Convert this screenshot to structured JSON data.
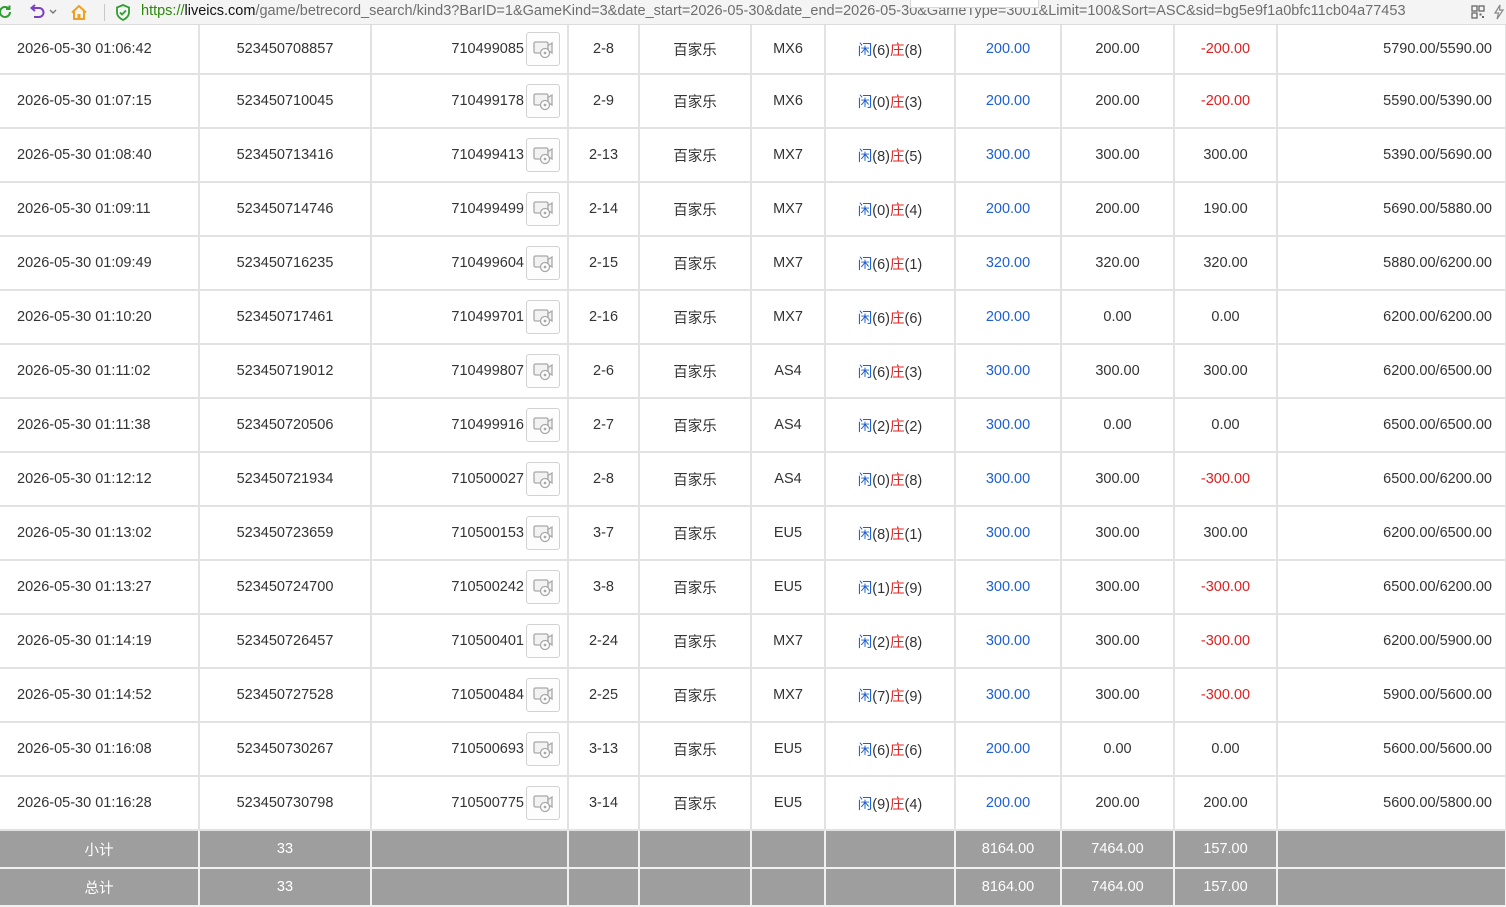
{
  "browser": {
    "url_scheme": "https://",
    "url_host": "liveics.com",
    "url_rest": "/game/betrecord_search/kind3?BarID=1&GameKind=3&date_start=2026-05-30&date_end=2026-05-30&GameType=3001&Limit=100&Sort=ASC&sid=bg5e9f1a0bfc11cb04a77453"
  },
  "player_label": "闲",
  "banker_label": "庄",
  "rows": [
    {
      "time": "2026-05-30 01:06:42",
      "bet_no": "523450708857",
      "game_no": "710499085",
      "shoe": "2-8",
      "game": "百家乐",
      "table": "MX6",
      "p": "(6)",
      "b": "(8)",
      "bet": "200.00",
      "valid": "200.00",
      "win": "-200.00",
      "neg": true,
      "balance": "5790.00/5590.00"
    },
    {
      "time": "2026-05-30 01:07:15",
      "bet_no": "523450710045",
      "game_no": "710499178",
      "shoe": "2-9",
      "game": "百家乐",
      "table": "MX6",
      "p": "(0)",
      "b": "(3)",
      "bet": "200.00",
      "valid": "200.00",
      "win": "-200.00",
      "neg": true,
      "balance": "5590.00/5390.00"
    },
    {
      "time": "2026-05-30 01:08:40",
      "bet_no": "523450713416",
      "game_no": "710499413",
      "shoe": "2-13",
      "game": "百家乐",
      "table": "MX7",
      "p": "(8)",
      "b": "(5)",
      "bet": "300.00",
      "valid": "300.00",
      "win": "300.00",
      "neg": false,
      "balance": "5390.00/5690.00"
    },
    {
      "time": "2026-05-30 01:09:11",
      "bet_no": "523450714746",
      "game_no": "710499499",
      "shoe": "2-14",
      "game": "百家乐",
      "table": "MX7",
      "p": "(0)",
      "b": "(4)",
      "bet": "200.00",
      "valid": "200.00",
      "win": "190.00",
      "neg": false,
      "balance": "5690.00/5880.00"
    },
    {
      "time": "2026-05-30 01:09:49",
      "bet_no": "523450716235",
      "game_no": "710499604",
      "shoe": "2-15",
      "game": "百家乐",
      "table": "MX7",
      "p": "(6)",
      "b": "(1)",
      "bet": "320.00",
      "valid": "320.00",
      "win": "320.00",
      "neg": false,
      "balance": "5880.00/6200.00"
    },
    {
      "time": "2026-05-30 01:10:20",
      "bet_no": "523450717461",
      "game_no": "710499701",
      "shoe": "2-16",
      "game": "百家乐",
      "table": "MX7",
      "p": "(6)",
      "b": "(6)",
      "bet": "200.00",
      "valid": "0.00",
      "win": "0.00",
      "neg": false,
      "balance": "6200.00/6200.00"
    },
    {
      "time": "2026-05-30 01:11:02",
      "bet_no": "523450719012",
      "game_no": "710499807",
      "shoe": "2-6",
      "game": "百家乐",
      "table": "AS4",
      "p": "(6)",
      "b": "(3)",
      "bet": "300.00",
      "valid": "300.00",
      "win": "300.00",
      "neg": false,
      "balance": "6200.00/6500.00"
    },
    {
      "time": "2026-05-30 01:11:38",
      "bet_no": "523450720506",
      "game_no": "710499916",
      "shoe": "2-7",
      "game": "百家乐",
      "table": "AS4",
      "p": "(2)",
      "b": "(2)",
      "bet": "300.00",
      "valid": "0.00",
      "win": "0.00",
      "neg": false,
      "balance": "6500.00/6500.00"
    },
    {
      "time": "2026-05-30 01:12:12",
      "bet_no": "523450721934",
      "game_no": "710500027",
      "shoe": "2-8",
      "game": "百家乐",
      "table": "AS4",
      "p": "(0)",
      "b": "(8)",
      "bet": "300.00",
      "valid": "300.00",
      "win": "-300.00",
      "neg": true,
      "balance": "6500.00/6200.00"
    },
    {
      "time": "2026-05-30 01:13:02",
      "bet_no": "523450723659",
      "game_no": "710500153",
      "shoe": "3-7",
      "game": "百家乐",
      "table": "EU5",
      "p": "(8)",
      "b": "(1)",
      "bet": "300.00",
      "valid": "300.00",
      "win": "300.00",
      "neg": false,
      "balance": "6200.00/6500.00"
    },
    {
      "time": "2026-05-30 01:13:27",
      "bet_no": "523450724700",
      "game_no": "710500242",
      "shoe": "3-8",
      "game": "百家乐",
      "table": "EU5",
      "p": "(1)",
      "b": "(9)",
      "bet": "300.00",
      "valid": "300.00",
      "win": "-300.00",
      "neg": true,
      "balance": "6500.00/6200.00"
    },
    {
      "time": "2026-05-30 01:14:19",
      "bet_no": "523450726457",
      "game_no": "710500401",
      "shoe": "2-24",
      "game": "百家乐",
      "table": "MX7",
      "p": "(2)",
      "b": "(8)",
      "bet": "300.00",
      "valid": "300.00",
      "win": "-300.00",
      "neg": true,
      "balance": "6200.00/5900.00"
    },
    {
      "time": "2026-05-30 01:14:52",
      "bet_no": "523450727528",
      "game_no": "710500484",
      "shoe": "2-25",
      "game": "百家乐",
      "table": "MX7",
      "p": "(7)",
      "b": "(9)",
      "bet": "300.00",
      "valid": "300.00",
      "win": "-300.00",
      "neg": true,
      "balance": "5900.00/5600.00"
    },
    {
      "time": "2026-05-30 01:16:08",
      "bet_no": "523450730267",
      "game_no": "710500693",
      "shoe": "3-13",
      "game": "百家乐",
      "table": "EU5",
      "p": "(6)",
      "b": "(6)",
      "bet": "200.00",
      "valid": "0.00",
      "win": "0.00",
      "neg": false,
      "balance": "5600.00/5600.00"
    },
    {
      "time": "2026-05-30 01:16:28",
      "bet_no": "523450730798",
      "game_no": "710500775",
      "shoe": "3-14",
      "game": "百家乐",
      "table": "EU5",
      "p": "(9)",
      "b": "(4)",
      "bet": "200.00",
      "valid": "200.00",
      "win": "200.00",
      "neg": false,
      "balance": "5600.00/5800.00"
    }
  ],
  "subtotal": {
    "label": "小计",
    "count": "33",
    "bet": "8164.00",
    "valid": "7464.00",
    "win": "157.00"
  },
  "total": {
    "label": "总计",
    "count": "33",
    "bet": "8164.00",
    "valid": "7464.00",
    "win": "157.00"
  },
  "colors": {
    "blue": "#1d5fd6",
    "red": "#e02020",
    "summary_bg": "#9e9e9e"
  }
}
